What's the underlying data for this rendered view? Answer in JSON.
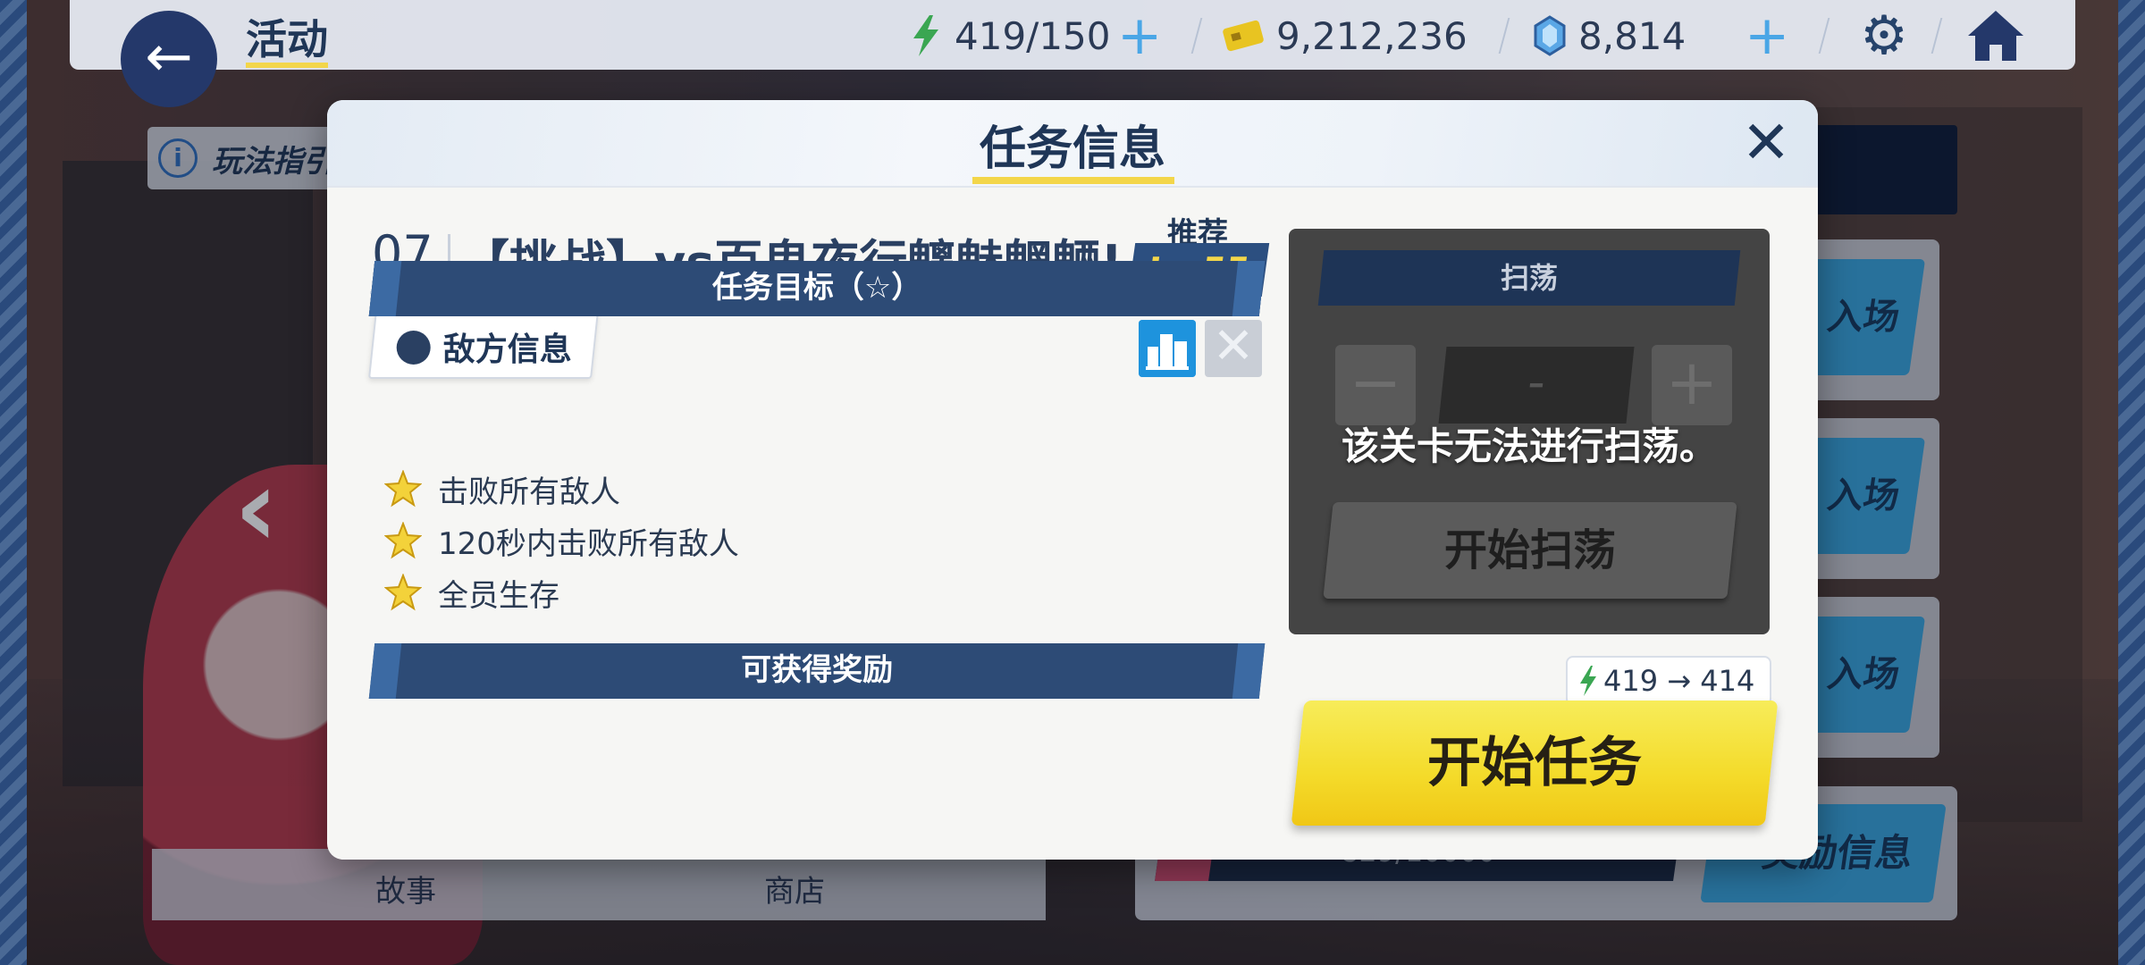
{
  "topbar": {
    "title": "活动",
    "stamina": "419/150",
    "credits": "9,212,236",
    "gems": "8,814"
  },
  "guide": {
    "label": "玩法指引"
  },
  "background": {
    "enter_label": "入场",
    "progress_text": "829/10000",
    "info_button": "奖励信息",
    "tabs": [
      "故事",
      "商店"
    ]
  },
  "modal": {
    "title": "任务信息",
    "stage_number": "07",
    "stage_name": "【挑战】vs百鬼夜行魑魅魍魉!",
    "recommend_label": "推荐",
    "recommend_level": "Lv.55",
    "enemy_info": "敌方信息",
    "objectives_header": "任务目标（☆）",
    "objectives": [
      "击败所有敌人",
      "120秒内击败所有敌人",
      "全员生存"
    ],
    "rewards_header": "可获得奖励",
    "sweep": {
      "header": "扫荡",
      "count": "-",
      "message": "该关卡无法进行扫荡。",
      "start": "开始扫荡"
    },
    "stamina_cost": "419 → 414",
    "start_button": "开始任务"
  },
  "colors": {
    "accent_yellow": "#f3d64a",
    "navy": "#1f3657",
    "blue": "#3aa7df"
  }
}
